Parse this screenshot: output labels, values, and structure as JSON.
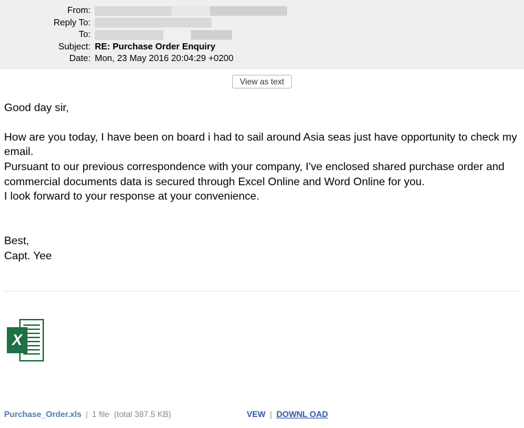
{
  "header": {
    "labels": {
      "from": "From:",
      "reply_to": "Reply To:",
      "to": "To:",
      "subject": "Subject:",
      "date": "Date:"
    },
    "subject": "RE: Purchase Order Enquiry",
    "date": "Mon, 23 May 2016 20:04:29 +0200"
  },
  "buttons": {
    "view_as_text": "View as text"
  },
  "body": {
    "greeting": "Good day sir,",
    "para1": "How are you today, I have been on board i had to sail around Asia seas just have opportunity to check my email.",
    "para2": "Pursuant to our previous correspondence with your company, I've enclosed shared purchase order and commercial documents data is secured through Excel Online and Word Online for you.",
    "para3": "I look forward to your response at your convenience.",
    "closing": "Best,",
    "signature": "Capt. Yee"
  },
  "attachment": {
    "filename": "Purchase_Order.xls",
    "file_count": "1 file",
    "file_size": "(total 387.5 KB)",
    "actions": {
      "view": "VEW",
      "download": "DOWNL OAD"
    }
  }
}
